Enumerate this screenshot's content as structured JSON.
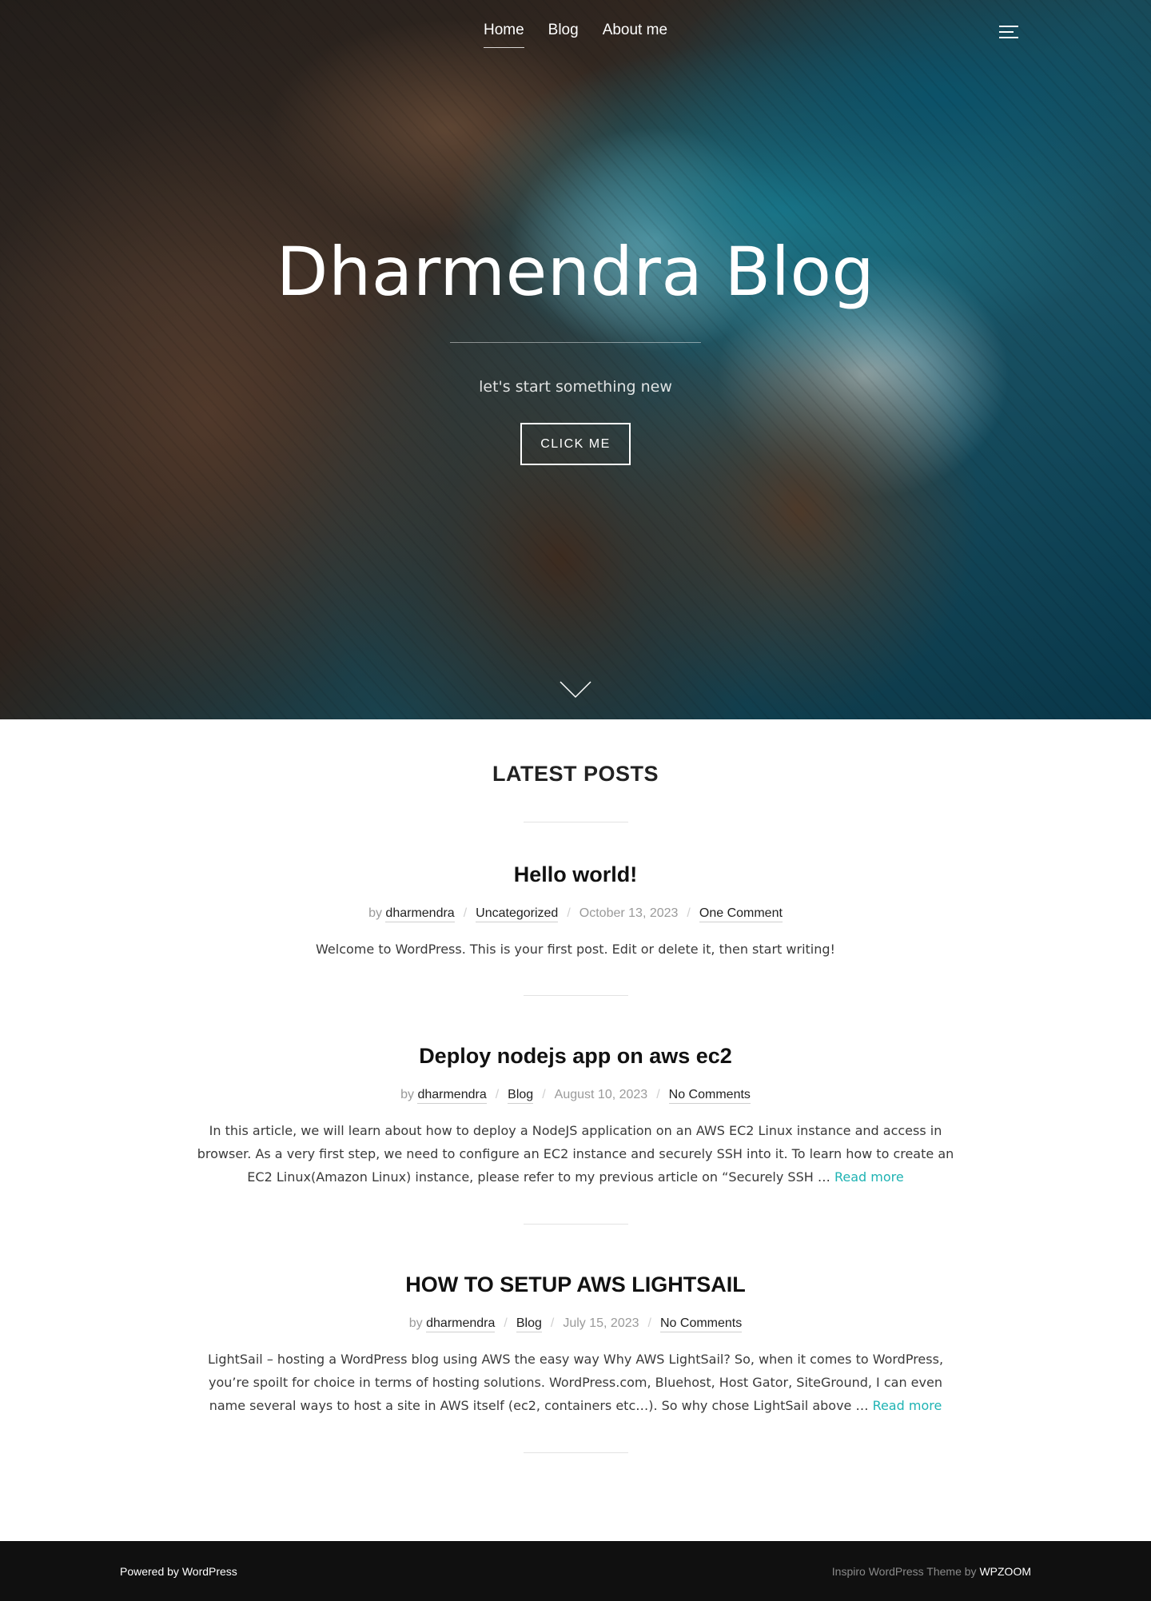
{
  "nav": {
    "items": [
      {
        "label": "Home",
        "active": true
      },
      {
        "label": "Blog",
        "active": false
      },
      {
        "label": "About me",
        "active": false
      }
    ],
    "menu_icon": "hamburger-menu-icon"
  },
  "hero": {
    "title": "Dharmendra Blog",
    "tagline": "let's start something new",
    "button_label": "CLICK ME",
    "scroll_icon": "chevron-down-icon"
  },
  "section": {
    "title": "LATEST POSTS"
  },
  "posts": [
    {
      "title": "Hello world!",
      "by": "by",
      "author": "dharmendra",
      "category": "Uncategorized",
      "date": "October 13, 2023",
      "comments": "One Comment",
      "excerpt": "Welcome to WordPress. This is your first post. Edit or delete it, then start writing!",
      "read_more": ""
    },
    {
      "title": "Deploy nodejs app on aws ec2",
      "by": "by",
      "author": "dharmendra",
      "category": "Blog",
      "date": "August 10, 2023",
      "comments": "No Comments",
      "excerpt": "In this article, we will learn about how to deploy a NodeJS application on an AWS EC2 Linux instance and access in browser. As a very first step, we need to configure an EC2 instance and securely SSH into it. To learn how to create an EC2 Linux(Amazon Linux) instance, please refer to my previous article on “Securely SSH …",
      "read_more": "Read more"
    },
    {
      "title": "HOW TO SETUP AWS LIGHTSAIL",
      "by": "by",
      "author": "dharmendra",
      "category": "Blog",
      "date": "July 15, 2023",
      "comments": "No Comments",
      "excerpt": "LightSail – hosting a WordPress blog using AWS the easy way Why AWS LightSail? So, when it comes to WordPress, you’re spoilt for choice in terms of hosting solutions. WordPress.com, Bluehost, Host Gator, SiteGround, I can even name several ways to host a site in AWS itself (ec2, containers etc…). So why chose LightSail above …",
      "read_more": "Read more"
    }
  ],
  "footer": {
    "left": "Powered by WordPress",
    "right_prefix": "Inspiro WordPress Theme by",
    "right_link": "WPZOOM"
  },
  "colors": {
    "accent": "#1fb3b3",
    "footer_bg": "#101010",
    "meta_gray": "#9a9a9a"
  }
}
